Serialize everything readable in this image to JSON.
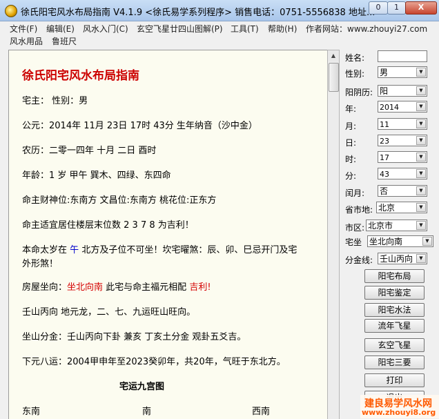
{
  "window": {
    "title": "徐氏阳宅风水布局指南 V4.1.9 <徐氏易学系列程序> 销售电话：0751-5556838  地址...",
    "min_glyph": "0",
    "max_glyph": "1",
    "close_glyph": "X"
  },
  "menu": {
    "items": [
      "文件(F)",
      "编辑(E)",
      "风水入门(C)",
      "玄空飞星廿四山图解(P)",
      "工具(T)",
      "帮助(H)",
      "作者网站：www.zhouyi27.com"
    ],
    "row2": [
      "风水用品",
      "鲁班尺"
    ]
  },
  "document": {
    "heading": "徐氏阳宅风水布局指南",
    "lines": {
      "owner": "宅主：  性别：男",
      "solar": "公元：2014年 11月 23日 17时 43分  生年纳音（沙中金）",
      "lunar": "农历：二零一四年  十月  二日  酉时",
      "age": "年龄：1 岁   甲午   巽木、四绿、东四命",
      "positions": "命主财神位:东南方   文昌位:东南方   桃花位:正东方",
      "floors": "命主适宜居住楼层末位数  2 3 7 8  为吉利！",
      "taisui_a": "本命太岁在",
      "taisui_b": "午",
      "taisui_c": "北方及子位不可坐！坎宅曜煞：辰、卯、巳忌开门及宅",
      "taisui_d": "外形煞！",
      "house_a": "房屋坐向：",
      "house_b": "坐北向南",
      "house_c": "此宅与命主福元相配",
      "house_d": "吉利!",
      "mountain": "壬山丙向  地元龙，二、七、九运旺山旺向。",
      "fenjin": "坐山分金：壬山丙向下卦   兼亥   丁亥土分金  观卦五爻吉。",
      "period": "下元八运：2004甲申年至2023癸卯年，共20年，气旺于东北方。",
      "palace_title": "宅运九宫图",
      "dir_a": "东南",
      "dir_b": "南",
      "dir_c": "西南"
    }
  },
  "form": {
    "name_label": "姓名:",
    "name_value": "",
    "gender_label": "性别:",
    "gender_value": "男",
    "calendar_label": "阳阴历:",
    "calendar_value": "阳",
    "year_label": "年:",
    "year_value": "2014",
    "month_label": "月:",
    "month_value": "11",
    "day_label": "日:",
    "day_value": "23",
    "hour_label": "时:",
    "hour_value": "17",
    "minute_label": "分:",
    "minute_value": "43",
    "leap_label": "闰月:",
    "leap_value": "否",
    "province_label": "省市地:",
    "province_value": "北京",
    "district_label": "市区:",
    "district_value": "北京市",
    "facing_label": "宅坐",
    "facing_value": "坐北向南",
    "fenjin_label": "分金线:",
    "fenjin_value": "壬山丙向"
  },
  "buttons": {
    "layout": "阳宅布局",
    "appraise": "阳宅鉴定",
    "water": "阳宅水法",
    "flying_year": "流年飞星",
    "xuankong": "玄空飞星",
    "essentials": "阳宅三要",
    "print": "打印",
    "exit": "退出"
  },
  "watermark": {
    "line1": "建良易学风水网",
    "line2": "www.zhouyi8.org"
  }
}
